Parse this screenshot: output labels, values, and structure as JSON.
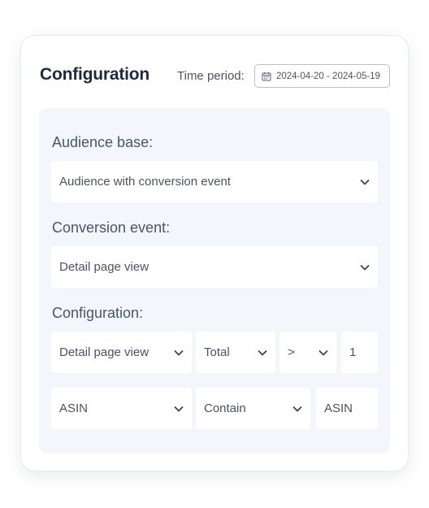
{
  "header": {
    "title": "Configuration",
    "time_period_label": "Time period:",
    "date_range": "2024-04-20 - 2024-05-19",
    "calendar_icon": "calendar-icon"
  },
  "audience": {
    "label": "Audience base:",
    "value": "Audience with conversion event"
  },
  "conversion": {
    "label": "Conversion event:",
    "value": "Detail page view"
  },
  "configuration": {
    "label": "Configuration:",
    "row1": {
      "event": "Detail page view",
      "aggregate": "Total",
      "operator": ">",
      "value": "1"
    },
    "row2": {
      "attribute": "ASIN",
      "match": "Contain",
      "value": "ASIN"
    }
  },
  "colors": {
    "panel_bg": "#f3f7fb",
    "title_text": "#1e2a3c",
    "field_text": "#4b5363"
  }
}
